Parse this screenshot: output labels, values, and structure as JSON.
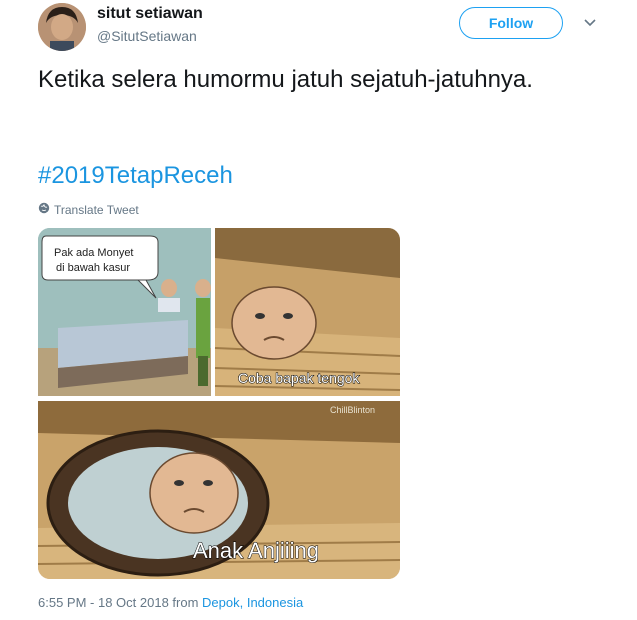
{
  "author": {
    "display_name": "situt setiawan",
    "handle": "@SitutSetiawan"
  },
  "follow_button": {
    "label": "Follow"
  },
  "tweet": {
    "text": "Ketika selera humormu jatuh sejatuh-jatuhnya.",
    "hashtag": "#2019TetapReceh",
    "translate_label": "Translate Tweet",
    "timestamp": "6:55 PM - 18 Oct 2018 from ",
    "location": "Depok, Indonesia"
  },
  "meme": {
    "bubble_line1": "Pak ada Monyet",
    "bubble_line2": "di bawah kasur",
    "caption_middle": "Coba bapak tengok",
    "caption_bottom": "Anak Anjiiing",
    "watermark": "ChillBlinton"
  },
  "colors": {
    "accent": "#1da1f2",
    "link": "#1b95e0",
    "muted": "#657786"
  }
}
